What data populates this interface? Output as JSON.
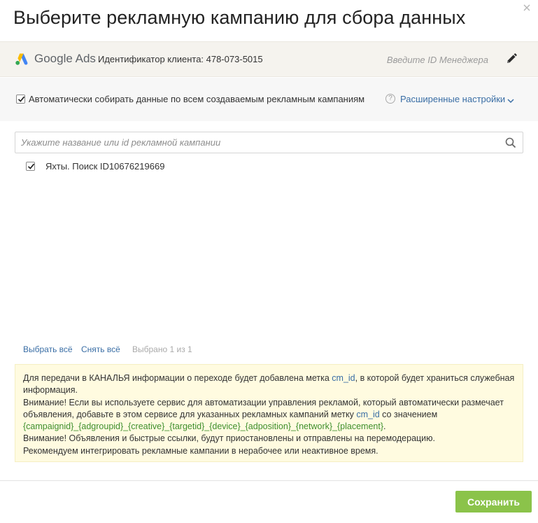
{
  "dialog": {
    "title": "Выберите рекламную кампанию для сбора данных",
    "close_icon": "close-icon"
  },
  "account": {
    "platform_name": "Google Ads",
    "client_id_label": "Идентификатор клиента: 478-073-5015",
    "manager_placeholder": "Введите ID Менеджера",
    "edit_icon": "pencil-icon"
  },
  "auto_collect": {
    "checked": true,
    "label": "Автоматически собирать данные по всем создаваемым рекламным кампаниям",
    "help_icon": "question-icon",
    "advanced_link": "Расширенные настройки"
  },
  "search": {
    "placeholder": "Укажите название или id рекламной кампании",
    "value": ""
  },
  "campaigns": [
    {
      "label": "Яхты. Поиск ID10676219669",
      "checked": true
    }
  ],
  "bulk": {
    "select_all": "Выбрать всё",
    "deselect_all": "Снять всё",
    "selected_count": "Выбрано 1 из 1"
  },
  "notice": {
    "p1_before": "Для передачи в КАНАЛЬЯ информации о переходе будет добавлена метка ",
    "p1_tag": "cm_id",
    "p1_after": ", в которой будет храниться служебная информация.",
    "p2_before": "Внимание! Если вы используете сервис для автоматизации управления рекламой, который автоматически размечает объявления, добавьте в этом сервисе для указанных рекламных кампаний метку ",
    "p2_tag": "cm_id",
    "p2_mid": " со значением ",
    "p2_code": "{campaignid}_{adgroupid}_{creative}_{targetid}_{device}_{adposition}_{network}_{placement}",
    "p2_after": ".",
    "p3": "Внимание! Объявления и быстрые ссылки, будут приостановлены и отправлены на перемодерацию.",
    "p4": "Рекомендуем интегрировать рекламные кампании в нерабочее или неактивное время."
  },
  "footer": {
    "save_label": "Сохранить"
  },
  "colors": {
    "link": "#3a6ea5",
    "code": "#3f8f2c",
    "save_button": "#8bc34a",
    "notice_bg": "#fffbe0"
  }
}
